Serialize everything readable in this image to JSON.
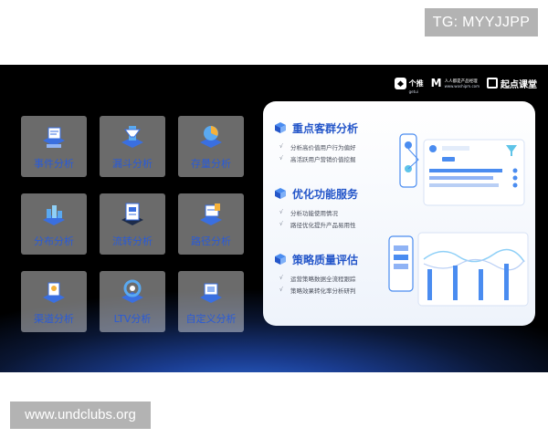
{
  "overlays": {
    "tg_label": "TG: MYYJJPP",
    "url_label": "www.undclubs.org"
  },
  "logos": {
    "brand1": "个推",
    "brand1_sub": "getui",
    "brand2_letter": "M",
    "brand2_text": "人人都是产品经理",
    "brand2_sub": "www.woshipm.com",
    "brand3": "起点课堂"
  },
  "tiles": [
    {
      "label": "事件分析",
      "icon": "event-analysis-icon"
    },
    {
      "label": "漏斗分析",
      "icon": "funnel-analysis-icon"
    },
    {
      "label": "存量分析",
      "icon": "stock-analysis-icon"
    },
    {
      "label": "分布分析",
      "icon": "distribution-analysis-icon"
    },
    {
      "label": "流转分析",
      "icon": "flow-analysis-icon"
    },
    {
      "label": "路径分析",
      "icon": "path-analysis-icon"
    },
    {
      "label": "渠道分析",
      "icon": "channel-analysis-icon"
    },
    {
      "label": "LTV分析",
      "icon": "ltv-analysis-icon"
    },
    {
      "label": "自定义分析",
      "icon": "custom-analysis-icon"
    }
  ],
  "sections": [
    {
      "title": "重点客群分析",
      "icon": "cube-icon",
      "items": [
        "分析高价值用户行为偏好",
        "高活跃用户营销价值挖掘"
      ]
    },
    {
      "title": "优化功能服务",
      "icon": "cube-icon",
      "items": [
        "分析功能使用情况",
        "路径优化提升产品易用性"
      ]
    },
    {
      "title": "策略质量评估",
      "icon": "cube-icon",
      "items": [
        "运营策略数据全流程跟踪",
        "策略效果转化率分析研判"
      ]
    }
  ],
  "check_mark": "√",
  "colors": {
    "accent": "#2456c9",
    "tile_label": "#2a5bd7",
    "slide_bg": "#000000",
    "glow": "#2f6fe0"
  }
}
